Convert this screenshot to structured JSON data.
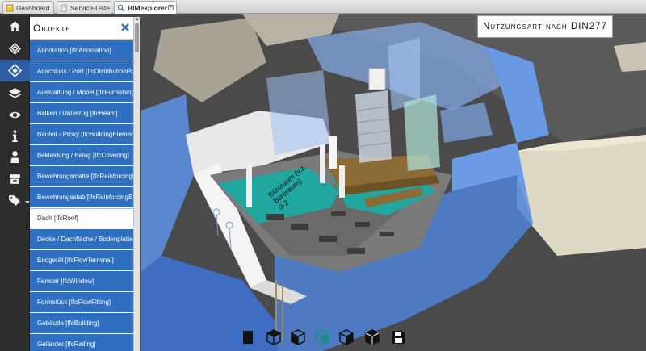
{
  "tabs": [
    {
      "label": "Dashboard",
      "active": false
    },
    {
      "label": "Service-Liste",
      "active": false
    },
    {
      "label": "BIMexplorer",
      "active": true
    }
  ],
  "rail": {
    "icons": [
      "home-icon",
      "diamond-outline-icon",
      "diamond-cube-icon",
      "layers-icon",
      "eye-icon",
      "info-icon",
      "person-icon",
      "archive-box-icon",
      "tags-icon"
    ],
    "active_index": 2
  },
  "objects_panel": {
    "title": "Objekte",
    "close_icon": "close-x-icon",
    "items": [
      "Annotation [IfcAnnotation]",
      "Anschluss / Port [IfcDistributionPort]",
      "Ausstattung / Möbel [IfcFurnishingElement]",
      "Balken / Unterzug [IfcBeam]",
      "Bauteil - Proxy [IfcBuildingElementProxy]",
      "Bekleidung / Belag [IfcCovering]",
      "Bewehrungsmatte [IfcReinforcingMesh]",
      "Bewehrungsstab [IfcReinforcingBar]",
      "Dach [IfcRoof]",
      "Decke / Dachfläche / Bodenplatte [IfcSlab]",
      "Endgerät [IfcFlowTerminal]",
      "Fenster [IfcWindow]",
      "Formstück [IfcFlowFitting]",
      "Gebäude [IfcBuilding]",
      "Geländer [IfcRailing]"
    ],
    "selected_index": 8
  },
  "viewer": {
    "title": "Nutzungsart nach DIN277",
    "room_label_lines": [
      "Büroraum (v.z.",
      "Büroraum)",
      "0-2"
    ]
  },
  "bottom_toolbar": {
    "icons": [
      "solid-box-icon",
      "cube-front-icon",
      "cube-left-icon",
      "cube-teal-icon",
      "cube-right-icon",
      "cube-top-icon",
      "save-disk-icon"
    ]
  },
  "colors": {
    "accent_blue": "#2e6fbf",
    "rail_bg": "#2d2d2d",
    "teal_floor": "#1fa7a0",
    "glass_blue": "#6fa3e8"
  }
}
